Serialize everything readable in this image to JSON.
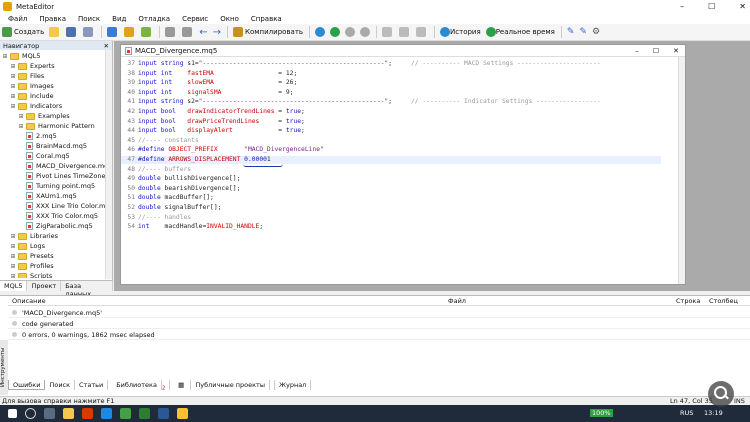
{
  "window": {
    "title": "MetaEditor",
    "controls": [
      "–",
      "☐",
      "✕"
    ]
  },
  "menu": [
    "Файл",
    "Правка",
    "Поиск",
    "Вид",
    "Отладка",
    "Сервис",
    "Окно",
    "Справка"
  ],
  "toolbar": {
    "create": "Создать",
    "compile": "Компилировать",
    "history": "История",
    "realtime": "Реальное время"
  },
  "navigator": {
    "title": "Навигатор",
    "close": "✕",
    "root": "MQL5",
    "items": [
      {
        "label": "Experts",
        "type": "folder",
        "level": 1
      },
      {
        "label": "Files",
        "type": "folder",
        "level": 1
      },
      {
        "label": "Images",
        "type": "folder",
        "level": 1
      },
      {
        "label": "Include",
        "type": "folder",
        "level": 1
      },
      {
        "label": "Indicators",
        "type": "folder",
        "level": 1
      },
      {
        "label": "Examples",
        "type": "folder",
        "level": 2
      },
      {
        "label": "Harmonic Pattern",
        "type": "folder",
        "level": 2
      },
      {
        "label": "2.mq5",
        "type": "file",
        "level": 2
      },
      {
        "label": "BrainMacd.mq5",
        "type": "file",
        "level": 2
      },
      {
        "label": "Coral.mq5",
        "type": "file",
        "level": 2
      },
      {
        "label": "MACD_Divergence.mq",
        "type": "file",
        "level": 2
      },
      {
        "label": "Pivot Lines TimeZone.",
        "type": "file",
        "level": 2
      },
      {
        "label": "Turning point.mq5",
        "type": "file",
        "level": 2
      },
      {
        "label": "XAUm1.mq5",
        "type": "file",
        "level": 2
      },
      {
        "label": "XXX Line Trio Color.m",
        "type": "file",
        "level": 2
      },
      {
        "label": "XXX Trio Color.mq5",
        "type": "file",
        "level": 2
      },
      {
        "label": "ZigParabolic.mq5",
        "type": "file",
        "level": 2
      },
      {
        "label": "Libraries",
        "type": "folder",
        "level": 1
      },
      {
        "label": "Logs",
        "type": "folder",
        "level": 1
      },
      {
        "label": "Presets",
        "type": "folder",
        "level": 1
      },
      {
        "label": "Profiles",
        "type": "folder",
        "level": 1
      },
      {
        "label": "Scripts",
        "type": "folder",
        "level": 1
      }
    ],
    "tabs": [
      "MQL5",
      "Проект",
      "База данных"
    ]
  },
  "editor": {
    "tab_title": "MACD_Divergence.mq5",
    "lines": [
      {
        "n": "37",
        "html": "<span class='kw'>input string</span> s1=<span class='str'>\"------------------------------------------------\"</span>;     <span class='cm'>// ---------- MACD Settings ----------------------</span>"
      },
      {
        "n": "38",
        "html": "<span class='kw'>input int</span>    <span class='red'>fastEMA</span>                 = 12;"
      },
      {
        "n": "39",
        "html": "<span class='kw'>input int</span>    <span class='red'>slowEMA</span>                 = 26;"
      },
      {
        "n": "40",
        "html": "<span class='kw'>input int</span>    <span class='red'>signalSMA</span>               = 9;"
      },
      {
        "n": "41",
        "html": "<span class='kw'>input string</span> s2=<span class='str'>\"------------------------------------------------\"</span>;     <span class='cm'>// ---------- Indicator Settings -----------------</span>"
      },
      {
        "n": "42",
        "html": "<span class='kw'>input bool</span>   <span class='red'>drawIndicatorTrendLines</span> = <span class='kw'>true</span>;"
      },
      {
        "n": "43",
        "html": "<span class='kw'>input bool</span>   <span class='red'>drawPriceTrendLines</span>     = <span class='kw'>true</span>;"
      },
      {
        "n": "44",
        "html": "<span class='kw'>input bool</span>   <span class='red'>displayAlert</span>            = <span class='kw'>true</span>;"
      },
      {
        "n": "45",
        "html": "<span class='cm'>//---- constants</span>"
      },
      {
        "n": "46",
        "html": "<span class='kw'>#define</span> <span class='red'>OBJECT_PREFIX</span>       <span class='str'>\"MACD_DivergenceLine\"</span>"
      },
      {
        "n": "47",
        "html": "<span class='kw'>#define</span> <span class='red'>ARROWS_DISPLACEMENT</span> <span class='kw'>0.0000</span>1"
      },
      {
        "n": "48",
        "html": "<span class='cm'>//---- buffers</span>"
      },
      {
        "n": "49",
        "html": "<span class='kw'>double</span> bullishDivergence[];"
      },
      {
        "n": "50",
        "html": "<span class='kw'>double</span> bearishDivergence[];"
      },
      {
        "n": "51",
        "html": "<span class='kw'>double</span> macdBuffer[];"
      },
      {
        "n": "52",
        "html": "<span class='kw'>double</span> signalBuffer[];"
      },
      {
        "n": "53",
        "html": "<span class='cm'>//---- handles</span>"
      },
      {
        "n": "54",
        "html": "<span class='kw'>int</span>    macdHandle=<span class='red'>INVALID_HANDLE</span>;"
      }
    ]
  },
  "toolbox": {
    "columns": [
      "Описание",
      "Файл",
      "Строка",
      "Столбец"
    ],
    "rows": [
      "'MACD_Divergence.mq5'",
      "code generated",
      "0 errors, 0 warnings, 1862 msec elapsed"
    ],
    "side_label": "Инструменты",
    "tabs": [
      "Ошибки",
      "Поиск",
      "Статьи",
      "Библиотека",
      "Публичные проекты",
      "Журнал"
    ],
    "library_badge": "2"
  },
  "status": {
    "help": "Для вызова справки нажмите F1",
    "position": "Ln 47, Col 35",
    "mode": "INS"
  },
  "taskbar": {
    "battery": "100%",
    "lang": "RUS",
    "time": "13:19"
  }
}
